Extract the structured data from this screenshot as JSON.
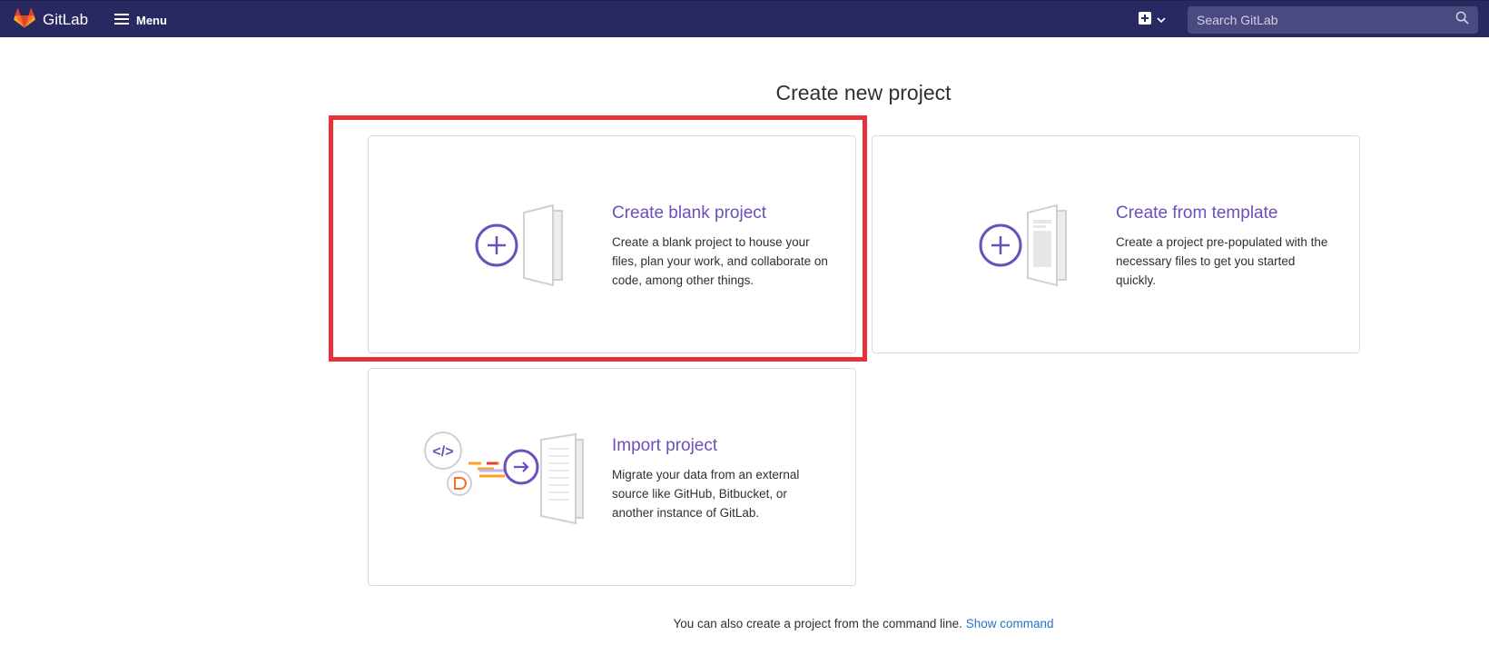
{
  "navbar": {
    "brand": "GitLab",
    "menu_label": "Menu",
    "search_placeholder": "Search GitLab"
  },
  "page": {
    "title": "Create new project"
  },
  "cards": {
    "blank": {
      "title": "Create blank project",
      "description": "Create a blank project to house your files, plan your work, and collaborate on code, among other things."
    },
    "template": {
      "title": "Create from template",
      "description": "Create a project pre-populated with the necessary files to get you started quickly."
    },
    "import": {
      "title": "Import project",
      "description": "Migrate your data from an external source like GitHub, Bitbucket, or another instance of GitLab."
    }
  },
  "footer": {
    "text": "You can also create a project from the command line.",
    "link": "Show command"
  },
  "colors": {
    "navbar": "#292961",
    "accent": "#6b4fbb",
    "link": "#1f75cb",
    "highlight": "#e8323a"
  }
}
